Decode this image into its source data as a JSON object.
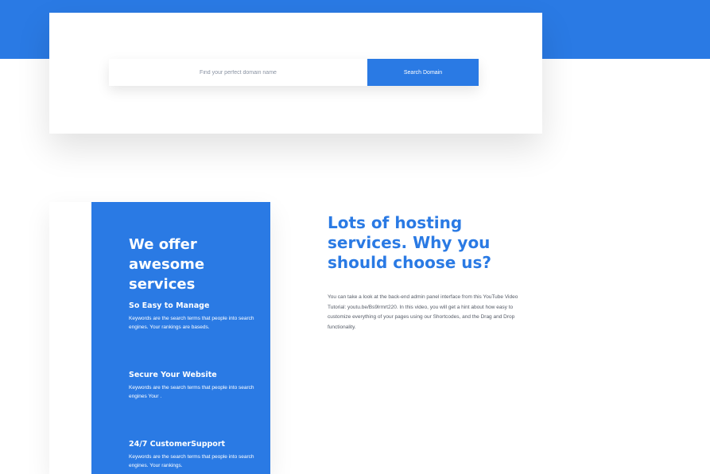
{
  "search": {
    "placeholder": "Find your perfect domain name",
    "button_label": "Search Domain"
  },
  "services": {
    "title": "We offer awesome services",
    "features": [
      {
        "title": "So Easy to Manage",
        "text": "Keywords are the search terms that people into search engines. Your rankings are baseds."
      },
      {
        "title": "Secure Your Website",
        "text": "Keywords are the search terms that people into search engines Your ."
      },
      {
        "title": "24/7 CustomerSupport",
        "text": "Keywords are the search terms that people into search engines. Your rankings."
      }
    ]
  },
  "about": {
    "headline": "Lots of hosting services. Why you should choose us?",
    "body": "You can take a look at the back-end admin panel interface from this YouTube Video Tutorial: youtu.be/Bs9lrmrt220. In this video, you will get a hint about how easy to customize everything of your pages using our Shortcodes, and the Drag and Drop functionality."
  },
  "colors": {
    "accent": "#2a7ae4",
    "text_muted": "#555b66",
    "placeholder": "#8a93a3"
  }
}
